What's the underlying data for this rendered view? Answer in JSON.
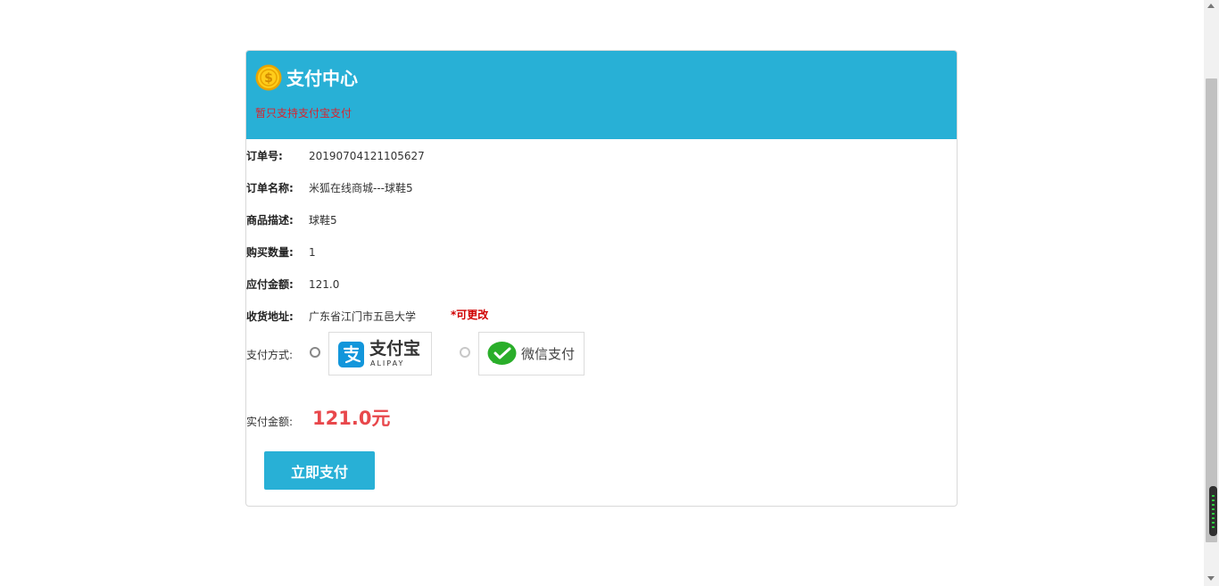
{
  "header": {
    "title": "支付中心",
    "notice": "暂只支持支付宝支付"
  },
  "order": {
    "rows": [
      {
        "label": "订单号:",
        "value": "20190704121105627"
      },
      {
        "label": "订单名称:",
        "value": "米狐在线商城---球鞋5"
      },
      {
        "label": "商品描述:",
        "value": "球鞋5"
      },
      {
        "label": "购买数量:",
        "value": "1"
      },
      {
        "label": "应付金额:",
        "value": "121.0"
      },
      {
        "label": "收货地址:",
        "value": "广东省江门市五邑大学"
      }
    ],
    "address_edit": "*可更改"
  },
  "payment": {
    "label": "支付方式:",
    "alipay": {
      "name": "支付宝",
      "sub": "ALIPAY"
    },
    "wechat": {
      "name": "微信支付"
    },
    "actual_label": "实付金额:",
    "actual_amount": "121.0元",
    "submit_label": "立即支付"
  },
  "colors": {
    "header_bg": "#28b0d6",
    "notice": "#d9232d",
    "amount": "#e8474b",
    "button_bg": "#28b0d6"
  },
  "icons": [
    "coin-icon",
    "alipay-logo-icon",
    "wechat-logo-icon"
  ]
}
